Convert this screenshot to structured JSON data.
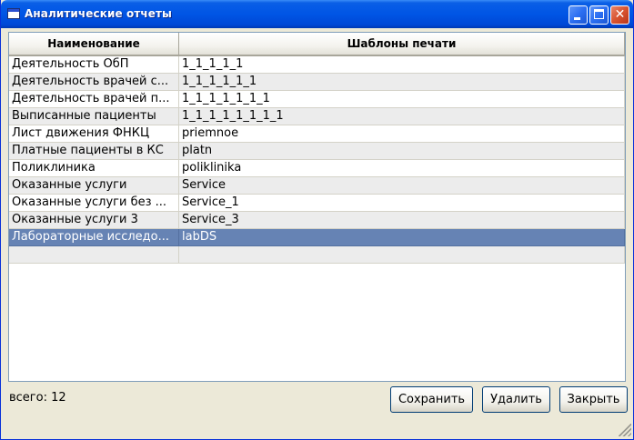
{
  "window": {
    "title": "Аналитические отчеты",
    "icon": "app-window-icon"
  },
  "table": {
    "columns": [
      "Наименование",
      "Шаблоны печати"
    ],
    "rows": [
      {
        "name": "Деятельность ОбП",
        "template": "1_1_1_1_1"
      },
      {
        "name": "Деятельность врачей с...",
        "template": "1_1_1_1_1_1"
      },
      {
        "name": "Деятельность врачей п...",
        "template": "1_1_1_1_1_1_1"
      },
      {
        "name": "Выписанные пациенты",
        "template": "1_1_1_1_1_1_1_1"
      },
      {
        "name": "Лист движения ФНКЦ",
        "template": "priemnoe"
      },
      {
        "name": "Платные пациенты в КС",
        "template": "platn"
      },
      {
        "name": "Поликлиника",
        "template": "poliklinika"
      },
      {
        "name": "Оказанные услуги",
        "template": "Service"
      },
      {
        "name": "Оказанные услуги без ...",
        "template": "Service_1"
      },
      {
        "name": "Оказанные услуги 3",
        "template": "Service_3"
      },
      {
        "name": "Лабораторные исследо...",
        "template": "labDS"
      },
      {
        "name": "",
        "template": ""
      }
    ],
    "selected_row_index": 10,
    "selection_color": "#6683b4"
  },
  "footer": {
    "count_label": "всего: 12",
    "save_label": "Сохранить",
    "delete_label": "Удалить",
    "close_label": "Закрыть"
  },
  "colors": {
    "titlebar": "#0055e5",
    "window_bg": "#ece9d8"
  }
}
